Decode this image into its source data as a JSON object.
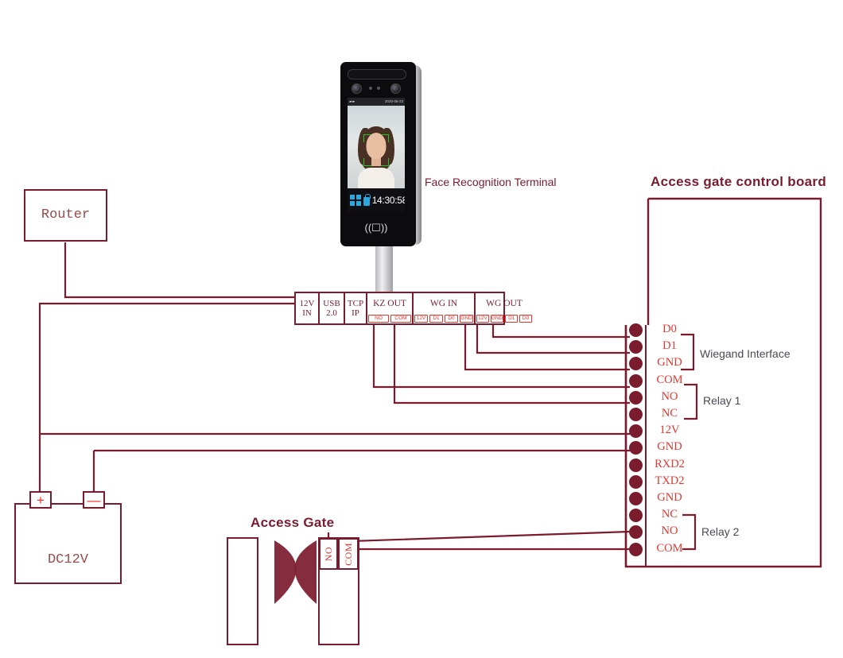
{
  "diagram": {
    "title_face_terminal": "Face Recognition Terminal",
    "title_control_board": "Access gate control board",
    "title_access_gate": "Access Gate",
    "router_label": "Router",
    "battery_label": "DC12V",
    "battery_positive": "+",
    "battery_negative": "—"
  },
  "terminal_strip": {
    "cells": [
      {
        "name": "12v-in",
        "title": "12V\nIN",
        "pins": []
      },
      {
        "name": "usb",
        "title": "USB\n2.0",
        "pins": []
      },
      {
        "name": "tcp-ip",
        "title": "TCP\nIP",
        "pins": []
      },
      {
        "name": "kz-out",
        "title": "KZ OUT",
        "pins": [
          "NO",
          "COM"
        ]
      },
      {
        "name": "wg-in",
        "title": "WG IN",
        "pins": [
          "12V",
          "D1",
          "D0",
          "GND"
        ]
      },
      {
        "name": "wg-out",
        "title": "WG OUT",
        "pins": [
          "12V",
          "GND",
          "D1",
          "D0"
        ]
      }
    ]
  },
  "control_board": {
    "pads": [
      {
        "label": "D0",
        "group": "wiegand"
      },
      {
        "label": "D1",
        "group": "wiegand"
      },
      {
        "label": "GND",
        "group": "wiegand"
      },
      {
        "label": "COM",
        "group": "relay1"
      },
      {
        "label": "NO",
        "group": "relay1"
      },
      {
        "label": "NC",
        "group": "relay1"
      },
      {
        "label": "12V",
        "group": ""
      },
      {
        "label": "GND",
        "group": ""
      },
      {
        "label": "RXD2",
        "group": ""
      },
      {
        "label": "TXD2",
        "group": ""
      },
      {
        "label": "GND",
        "group": ""
      },
      {
        "label": "NC",
        "group": "relay2"
      },
      {
        "label": "NO",
        "group": "relay2"
      },
      {
        "label": "COM",
        "group": "relay2"
      }
    ],
    "groups": {
      "wiegand": "Wiegand Interface",
      "relay1": "Relay 1",
      "relay2": "Relay 2"
    }
  },
  "access_gate": {
    "pins": [
      "NO",
      "COM"
    ]
  },
  "device": {
    "status_date": "2020-06-23",
    "status_signal": "▰▰",
    "time": "14:30:58"
  },
  "colors": {
    "wire": "#7b1b2e",
    "accent_red": "#e8352e",
    "pad": "#7b1b2e",
    "group_text": "#4a4a55"
  }
}
